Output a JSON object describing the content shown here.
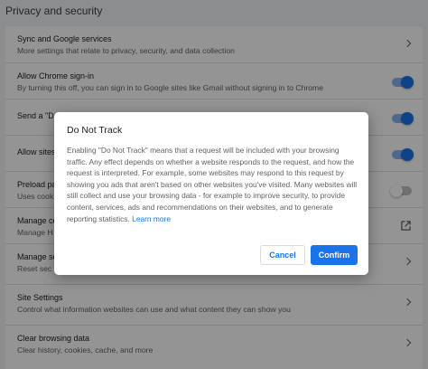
{
  "section": {
    "title": "Privacy and security"
  },
  "rows": [
    {
      "title": "Sync and Google services",
      "sub": "More settings that relate to privacy, security, and data collection",
      "control": "chevron"
    },
    {
      "title": "Allow Chrome sign-in",
      "sub": "By turning this off, you can sign in to Google sites like Gmail without signing in to Chrome",
      "control": "toggle-on"
    },
    {
      "title": "Send a \"Do",
      "sub": "",
      "control": "toggle-on"
    },
    {
      "title": "Allow sites",
      "sub": "",
      "control": "toggle-on"
    },
    {
      "title": "Preload pa",
      "sub": "Uses cook",
      "control": "toggle-off"
    },
    {
      "title": "Manage ce",
      "sub": "Manage H",
      "control": "external"
    },
    {
      "title": "Manage se",
      "sub": "Reset sec",
      "control": "chevron"
    },
    {
      "title": "Site Settings",
      "sub": "Control what information websites can use and what content they can show you",
      "control": "chevron"
    },
    {
      "title": "Clear browsing data",
      "sub": "Clear history, cookies, cache, and more",
      "control": "chevron"
    }
  ],
  "dialog": {
    "title": "Do Not Track",
    "body": "Enabling \"Do Not Track\" means that a request will be included with your browsing traffic. Any effect depends on whether a website responds to the request, and how the request is interpreted. For example, some websites may respond to this request by showing you ads that aren't based on other websites you've visited. Many websites will still collect and use your browsing data - for example to improve security, to provide content, services, ads and recommendations on their websites, and to generate reporting statistics.",
    "learn_more": "Learn more",
    "cancel_label": "Cancel",
    "confirm_label": "Confirm"
  },
  "colors": {
    "accent": "#1a73e8",
    "toggle_track": "#8ab4f8",
    "page_bg": "#f1f3f4"
  }
}
